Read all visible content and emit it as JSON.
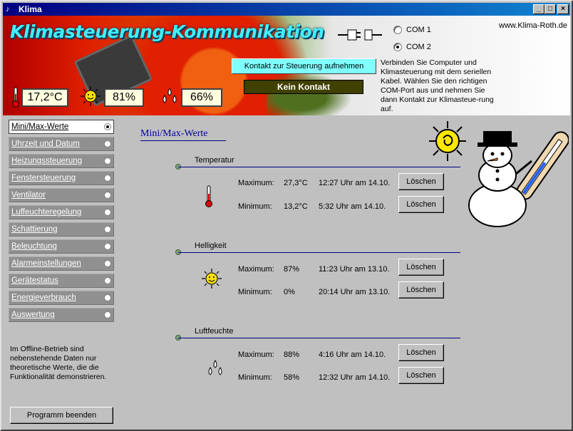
{
  "window": {
    "title": "Klima",
    "buttons": {
      "minimize": "_",
      "maximize": "□",
      "close": "×"
    }
  },
  "header": {
    "app_title": "Klimasteuerung-Kommunikation",
    "url": "www.Klima-Roth.de",
    "ports": [
      {
        "label": "COM 1",
        "selected": false
      },
      {
        "label": "COM 2",
        "selected": true
      }
    ],
    "connect_button": "Kontakt zur Steuerung aufnehmen",
    "status": "Kein Kontakt",
    "help": "Verbinden Sie Computer und Klimasteuerung mit dem seriellen Kabel. Wählen Sie den richtigen COM-Port aus und nehmen Sie dann Kontakt zur Klimasteue-rung auf.",
    "readings": {
      "temperature": "17,2°C",
      "brightness": "81%",
      "humidity": "66%"
    }
  },
  "nav": {
    "items": [
      {
        "label": "Mini/Max-Werte",
        "active": true
      },
      {
        "label": "Uhrzeit und Datum",
        "active": false
      },
      {
        "label": "Heizungssteuerung",
        "active": false
      },
      {
        "label": "Fenstersteuerung",
        "active": false
      },
      {
        "label": "Ventilator",
        "active": false
      },
      {
        "label": "Luffeuchteregelung",
        "active": false
      },
      {
        "label": "Schattierung",
        "active": false
      },
      {
        "label": "Beleuchtung",
        "active": false
      },
      {
        "label": "Alarmeinstellungen",
        "active": false
      },
      {
        "label": "Gerätestatus",
        "active": false
      },
      {
        "label": "Energieverbrauch",
        "active": false
      },
      {
        "label": "Auswertung",
        "active": false
      }
    ],
    "offline_note": "Im Offline-Betrieb sind nebenstehende Daten nur theoretische Werte, die die Funktionalität demonstrieren.",
    "quit_button": "Programm beenden"
  },
  "main": {
    "title": "Mini/Max-Werte",
    "clear_label": "Löschen",
    "groups": [
      {
        "name": "Temperatur",
        "rows": [
          {
            "kind": "Maximum:",
            "value": "27,3°C",
            "time": "12:27 Uhr am 14.10."
          },
          {
            "kind": "Minimum:",
            "value": "13,2°C",
            "time": "5:32 Uhr am 14.10."
          }
        ]
      },
      {
        "name": "Helligkeit",
        "rows": [
          {
            "kind": "Maximum:",
            "value": "87%",
            "time": "11:23 Uhr am 13.10."
          },
          {
            "kind": "Minimum:",
            "value": "0%",
            "time": "20:14 Uhr am 13.10."
          }
        ]
      },
      {
        "name": "Luftfeuchte",
        "rows": [
          {
            "kind": "Maximum:",
            "value": "88%",
            "time": "4:16 Uhr am 14.10."
          },
          {
            "kind": "Minimum:",
            "value": "58%",
            "time": "12:32 Uhr am 14.10."
          }
        ]
      }
    ]
  },
  "icons": {
    "thermometer": "thermometer-icon",
    "sun": "sun-icon",
    "drops": "water-drops-icon",
    "plug": "plug-icon",
    "mascot": "snowman-thermometer-icon"
  }
}
